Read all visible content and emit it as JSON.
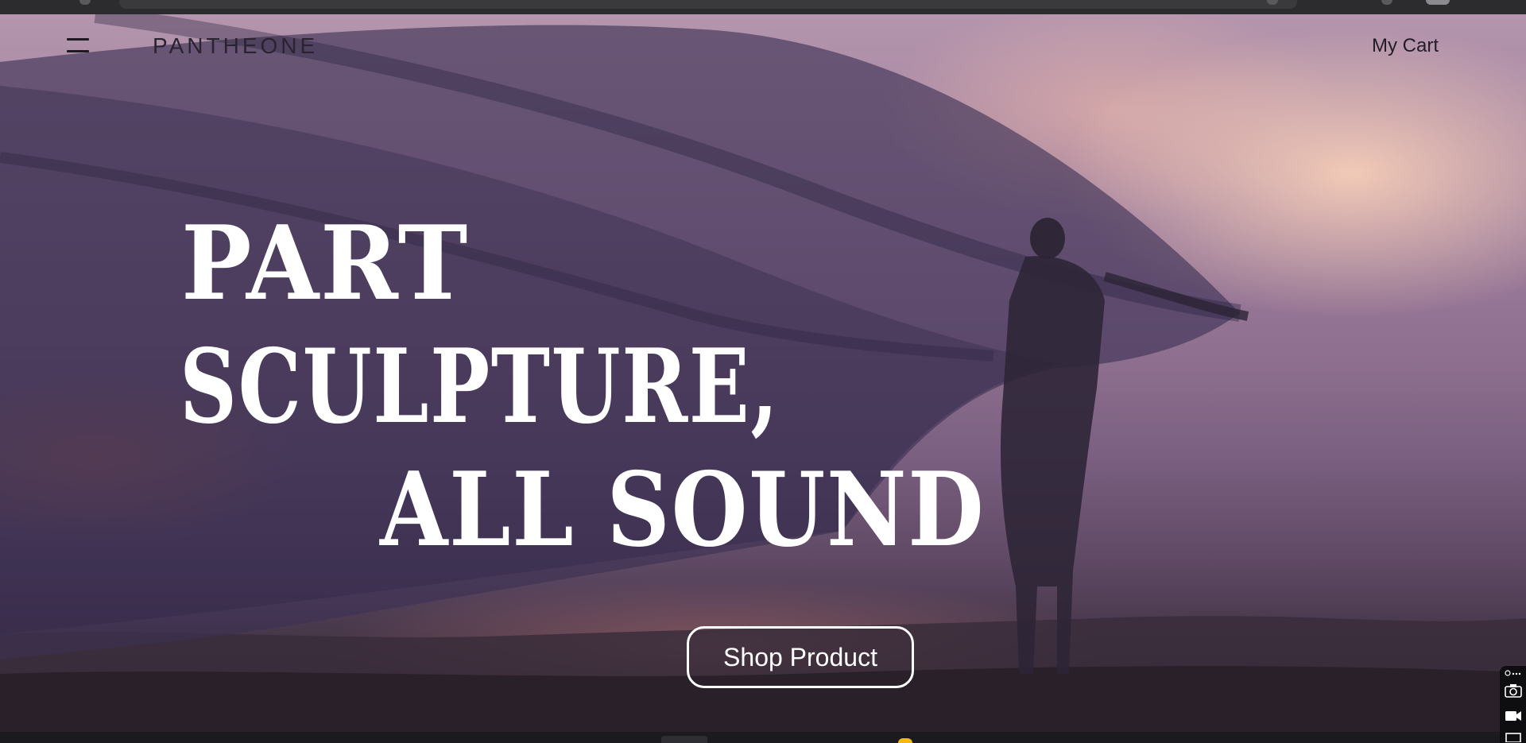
{
  "header": {
    "brand": "PANTHEONE",
    "cart_label": "My Cart",
    "menu_icon": "hamburger-menu-icon"
  },
  "hero": {
    "headline_lines": [
      "PART",
      "SCULPTURE,",
      "ALL SOUND"
    ],
    "cta_label": "Shop Product"
  },
  "side_tools": [
    {
      "name": "link-more-icon"
    },
    {
      "name": "camera-icon"
    },
    {
      "name": "video-camera-icon"
    },
    {
      "name": "window-icon"
    }
  ],
  "colors": {
    "headline": "#ffffff",
    "header_text": "#231d28",
    "sky_top": "#b495ad",
    "sky_bottom": "#2b2229",
    "fabric": "#3b3154"
  }
}
